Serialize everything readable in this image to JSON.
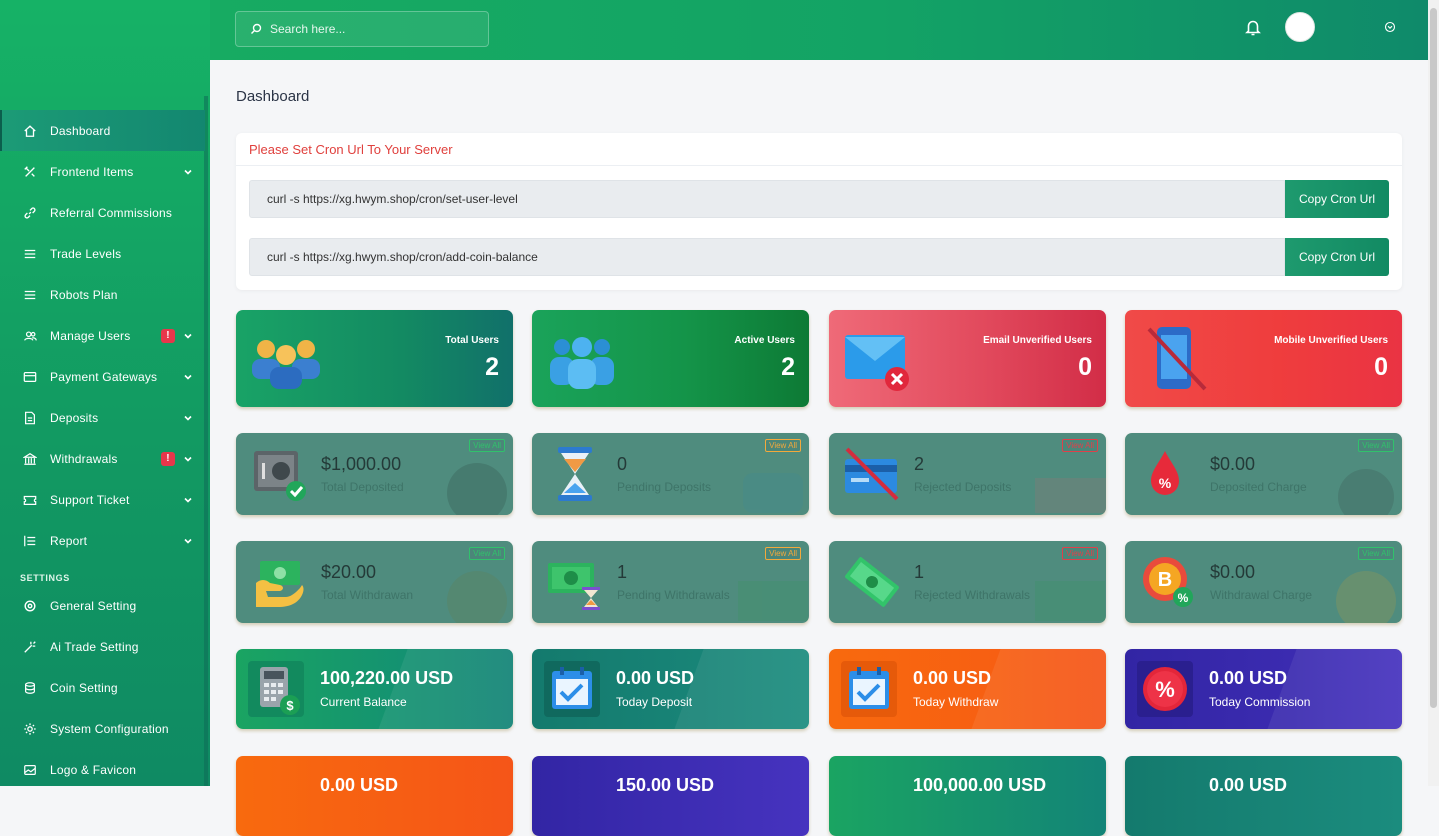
{
  "search": {
    "placeholder": "Search here..."
  },
  "sidebar": {
    "items": [
      {
        "label": "Dashboard",
        "icon": "home-icon",
        "active": true
      },
      {
        "label": "Frontend Items",
        "icon": "tools-icon",
        "chevron": true
      },
      {
        "label": "Referral Commissions",
        "icon": "link-icon"
      },
      {
        "label": "Trade Levels",
        "icon": "list-icon"
      },
      {
        "label": "Robots Plan",
        "icon": "list-icon"
      },
      {
        "label": "Manage Users",
        "icon": "users-icon",
        "badge": "!",
        "chevron": true
      },
      {
        "label": "Payment Gateways",
        "icon": "credit-card-icon",
        "chevron": true
      },
      {
        "label": "Deposits",
        "icon": "file-icon",
        "chevron": true
      },
      {
        "label": "Withdrawals",
        "icon": "bank-icon",
        "badge": "!",
        "chevron": true
      },
      {
        "label": "Support Ticket",
        "icon": "ticket-icon",
        "chevron": true
      },
      {
        "label": "Report",
        "icon": "report-icon",
        "chevron": true
      }
    ],
    "settings_title": "SETTINGS",
    "settings": [
      {
        "label": "General Setting",
        "icon": "cog-icon"
      },
      {
        "label": "Ai Trade Setting",
        "icon": "magic-icon"
      },
      {
        "label": "Coin Setting",
        "icon": "coins-icon"
      },
      {
        "label": "System Configuration",
        "icon": "gear-icon"
      },
      {
        "label": "Logo & Favicon",
        "icon": "image-icon"
      }
    ]
  },
  "page": {
    "title": "Dashboard"
  },
  "cron": {
    "title": "Please Set Cron Url To Your Server",
    "rows": [
      {
        "url": "curl -s https://xg.hwym.shop/cron/set-user-level",
        "button": "Copy Cron Url"
      },
      {
        "url": "curl -s https://xg.hwym.shop/cron/add-coin-balance",
        "button": "Copy Cron Url"
      }
    ]
  },
  "stats": [
    {
      "title": "Total Users",
      "value": "2",
      "icon": "users-group-icon"
    },
    {
      "title": "Active Users",
      "value": "2",
      "icon": "users-icon"
    },
    {
      "title": "Email Unverified Users",
      "value": "0",
      "icon": "mail-x-icon"
    },
    {
      "title": "Mobile Unverified Users",
      "value": "0",
      "icon": "mobile-off-icon"
    }
  ],
  "deposit_cards": [
    {
      "value": "$1,000.00",
      "label": "Total Deposited",
      "view_all": "View All",
      "icon": "safe-icon"
    },
    {
      "value": "0",
      "label": "Pending Deposits",
      "view_all": "View All",
      "icon": "hourglass-icon"
    },
    {
      "value": "2",
      "label": "Rejected Deposits",
      "view_all": "View All",
      "icon": "card-off-icon"
    },
    {
      "value": "$0.00",
      "label": "Deposited Charge",
      "view_all": "View All",
      "icon": "percent-drop-icon"
    }
  ],
  "withdraw_cards": [
    {
      "value": "$20.00",
      "label": "Total Withdrawan",
      "view_all": "View All",
      "icon": "cash-hand-icon"
    },
    {
      "value": "1",
      "label": "Pending Withdrawals",
      "view_all": "View All",
      "icon": "cash-hourglass-icon"
    },
    {
      "value": "1",
      "label": "Rejected Withdrawals",
      "view_all": "View All",
      "icon": "cash-x-icon"
    },
    {
      "value": "$0.00",
      "label": "Withdrawal Charge",
      "view_all": "View All",
      "icon": "bitcoin-percent-icon"
    }
  ],
  "balance_cards": [
    {
      "value": "100,220.00 USD",
      "label": "Current Balance",
      "icon": "calculator-icon"
    },
    {
      "value": "0.00 USD",
      "label": "Today Deposit",
      "icon": "calendar-check-icon"
    },
    {
      "value": "0.00 USD",
      "label": "Today Withdraw",
      "icon": "calendar-check-icon"
    },
    {
      "value": "0.00 USD",
      "label": "Today Commission",
      "icon": "percent-badge-icon"
    }
  ],
  "bottom_cards": [
    {
      "value": "0.00 USD"
    },
    {
      "value": "150.00 USD"
    },
    {
      "value": "100,000.00 USD"
    },
    {
      "value": "0.00 USD"
    }
  ]
}
